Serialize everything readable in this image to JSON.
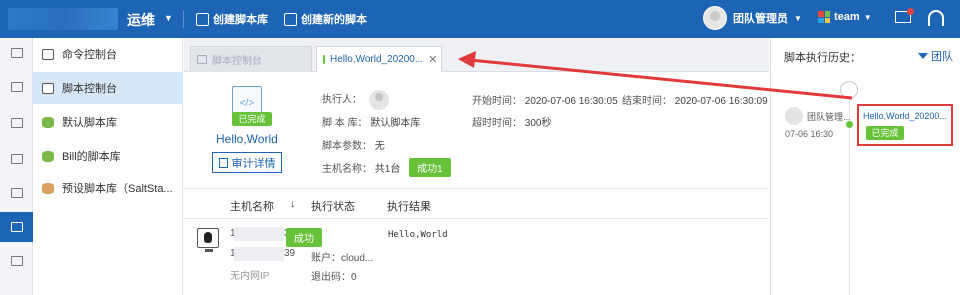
{
  "topbar": {
    "app_title": "运维",
    "create_lib_btn": "创建脚本库",
    "create_script_btn": "创建新的脚本",
    "user_name": "团队管理员",
    "team_name": "team",
    "colors": {
      "bg": "#1e64b4"
    }
  },
  "rail": {
    "items": [
      "monitor-icon",
      "topology-icon",
      "database-icon",
      "cloud-icon",
      "folder-icon",
      "document-icon",
      "clipboard-icon"
    ],
    "active_index": 5
  },
  "menu": {
    "items": [
      {
        "label": "命令控制台",
        "icon": "terminal-icon"
      },
      {
        "label": "脚本控制台",
        "icon": "script-icon"
      },
      {
        "label": "默认脚本库",
        "icon": "database-icon"
      },
      {
        "label": "Bill的脚本库",
        "icon": "database-icon"
      },
      {
        "label": "预设脚本库（SaltSta...",
        "icon": "database-icon"
      }
    ],
    "active_index": 1
  },
  "tabs": {
    "inactive": "脚本控制台",
    "active": "Hello,World_20200..."
  },
  "script": {
    "status": "已完成",
    "name": "Hello,World",
    "audit_btn": "审计详情"
  },
  "info": {
    "executor_label": "执行人：",
    "lib_label": "脚 本 库：",
    "lib_value": "默认脚本库",
    "params_label": "脚本参数：",
    "params_value": "无",
    "hosts_label": "主机名称：",
    "hosts_value": "共1台",
    "hosts_status": "成功1",
    "start_label": "开始时间：",
    "start_value": "2020-07-06 16:30:05",
    "end_label": "结束时间：",
    "end_value": "2020-07-06 16:30:09",
    "timeout_label": "超时时间：",
    "timeout_value": "300秒"
  },
  "table": {
    "headers": {
      "host": "主机名称",
      "sort": "↓",
      "status": "执行状态",
      "result": "执行结果"
    },
    "rows": [
      {
        "ip1_prefix": "1",
        "ip1_suffix": "39",
        "ip2_prefix": "1",
        "ip2_suffix": "39",
        "inner_ip": "无内网IP",
        "status": "成功",
        "account": "账户：cloud...",
        "exit_code": "退出码：0",
        "result": "Hello,World"
      }
    ]
  },
  "history": {
    "title": "脚本执行历史：",
    "filter": "团队",
    "entry": {
      "user": "团队管理...",
      "time": "07-06 16:30",
      "name": "Hello,World_20200...",
      "status": "已完成"
    }
  }
}
